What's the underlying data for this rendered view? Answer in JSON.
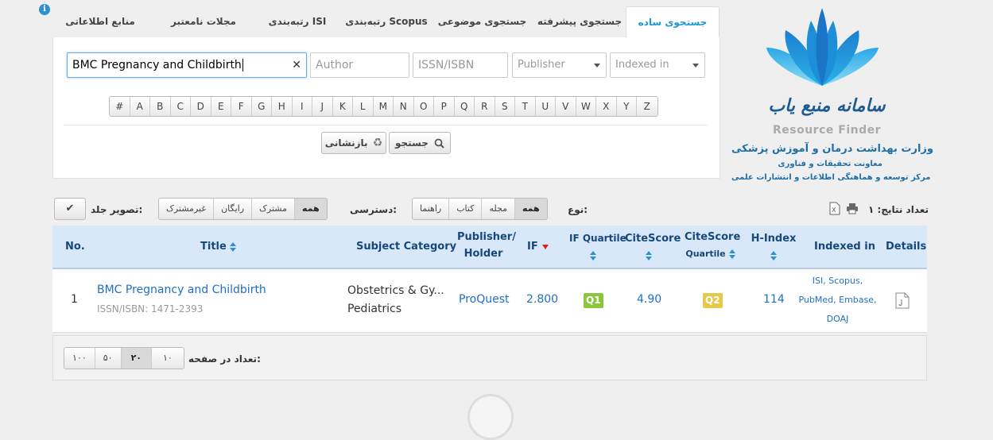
{
  "tabs": [
    "جستجوی ساده",
    "جستجوی پیشرفته",
    "جستجوی موضوعی",
    "رتبه‌بندی Scopus",
    "رتبه‌بندی ISI",
    "مجلات نامعتبر",
    "منابع اطلاعاتی"
  ],
  "search": {
    "query": "BMC Pregnancy and Childbirth",
    "author_placeholder": "Author",
    "issn_placeholder": "ISSN/ISBN",
    "publisher_placeholder": "Publisher",
    "indexed_placeholder": "Indexed in",
    "letters": [
      "#",
      "A",
      "B",
      "C",
      "D",
      "E",
      "F",
      "G",
      "H",
      "I",
      "J",
      "K",
      "L",
      "M",
      "N",
      "O",
      "P",
      "Q",
      "R",
      "S",
      "T",
      "U",
      "V",
      "W",
      "X",
      "Y",
      "Z"
    ],
    "search_label": "جستجو",
    "reset_label": "بازنشانی"
  },
  "brand": {
    "title_fa": "سامانه منبع یاب",
    "title_en": "Resource Finder",
    "ministry": "وزارت بهداشت درمان و آموزش پزشکی",
    "deputy": "معاونت تحقیقات و فناوری",
    "center": "مرکز توسعه و هماهنگی اطلاعات و انتشارات علمی"
  },
  "filters": {
    "results_label": "تعداد نتایج: ۱",
    "type_label": "نوع:",
    "type_options": [
      "همه",
      "مجله",
      "کتاب",
      "راهنما"
    ],
    "access_label": "دسترسی:",
    "access_options": [
      "همه",
      "مشترک",
      "رایگان",
      "غیرمشترک"
    ],
    "cover_label": "تصویر جلد:"
  },
  "table": {
    "headers": {
      "no": "No.",
      "title": "Title",
      "subject": "Subject Category",
      "publisher_line1": "Publisher/",
      "publisher_line2": "Holder",
      "if": "IF",
      "if_quartile": "IF Quartile",
      "citescore": "CiteScore",
      "cs_quartile_line1": "CiteScore",
      "cs_quartile_line2": "Quartile",
      "hindex": "H-Index",
      "indexed": "Indexed in",
      "details": "Details"
    },
    "rows": [
      {
        "no": "1",
        "title": "BMC Pregnancy and Childbirth",
        "issn": "ISSN/ISBN: 1471-2393",
        "subject_1": "Obstetrics & Gy...",
        "subject_2": "Pediatrics",
        "publisher": "ProQuest",
        "if": "2.800",
        "if_quartile": "Q1",
        "citescore": "4.90",
        "cs_quartile": "Q2",
        "hindex": "114",
        "indexed_1": "ISI, Scopus,",
        "indexed_2": "PubMed, Embase,",
        "indexed_3": "DOAJ"
      }
    ]
  },
  "pager": {
    "label": "تعداد در صفحه:",
    "sizes": [
      "۱۰",
      "۲۰",
      "۵۰",
      "۱۰۰"
    ],
    "selected": "۲۰"
  },
  "colors": {
    "accent": "#1e97d5",
    "q1": "#8cc63f",
    "q2": "#e6c84a",
    "header_bg": "#d9e8f8"
  }
}
